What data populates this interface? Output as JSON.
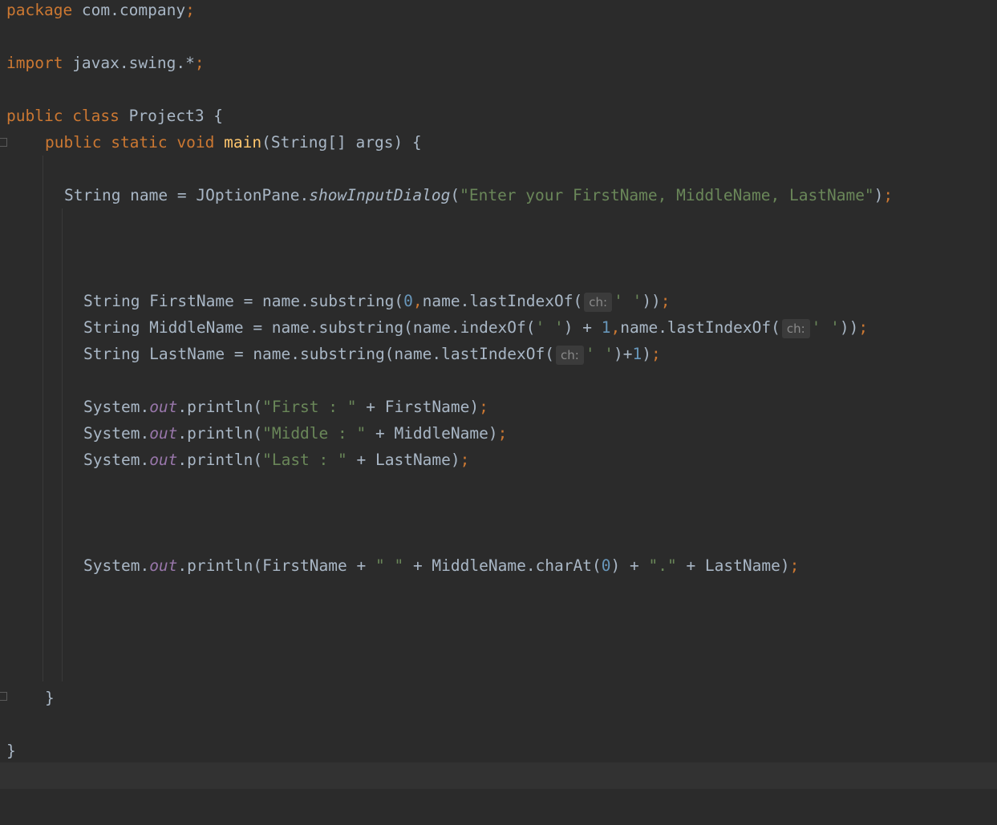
{
  "code": {
    "lines": [
      {
        "indent": 0,
        "tokens": [
          {
            "t": "package",
            "c": "kw"
          },
          {
            "t": " com.company"
          },
          {
            "t": ";",
            "c": "kw"
          }
        ]
      },
      {
        "indent": 0,
        "tokens": []
      },
      {
        "indent": 0,
        "tokens": [
          {
            "t": "import",
            "c": "kw"
          },
          {
            "t": " javax.swing.*"
          },
          {
            "t": ";",
            "c": "kw"
          }
        ]
      },
      {
        "indent": 0,
        "tokens": []
      },
      {
        "indent": 0,
        "tokens": [
          {
            "t": "public",
            "c": "kw"
          },
          {
            "t": " "
          },
          {
            "t": "class",
            "c": "kw"
          },
          {
            "t": " Project3 {"
          }
        ]
      },
      {
        "indent": 1,
        "tokens": [
          {
            "t": "public",
            "c": "kw"
          },
          {
            "t": " "
          },
          {
            "t": "static",
            "c": "kw"
          },
          {
            "t": " "
          },
          {
            "t": "void",
            "c": "kw"
          },
          {
            "t": " "
          },
          {
            "t": "main",
            "c": "mdecl"
          },
          {
            "t": "(String[] args) {"
          }
        ]
      },
      {
        "indent": 0,
        "tokens": []
      },
      {
        "indent": 1.5,
        "tokens": [
          {
            "t": "String name = JOptionPane."
          },
          {
            "t": "showInputDialog",
            "c": "static-m"
          },
          {
            "t": "("
          },
          {
            "t": "\"Enter your FirstName, MiddleName, LastName\"",
            "c": "str"
          },
          {
            "t": ")"
          },
          {
            "t": ";",
            "c": "kw"
          }
        ]
      },
      {
        "indent": 0,
        "tokens": []
      },
      {
        "indent": 0,
        "tokens": []
      },
      {
        "indent": 0,
        "tokens": []
      },
      {
        "indent": 2,
        "tokens": [
          {
            "t": "String FirstName = name.substring("
          },
          {
            "t": "0",
            "c": "num"
          },
          {
            "t": ",",
            "c": "kw"
          },
          {
            "t": "name.lastIndexOf("
          },
          {
            "t": "ch:",
            "c": "hint"
          },
          {
            "t": "' '",
            "c": "str"
          },
          {
            "t": "))"
          },
          {
            "t": ";",
            "c": "kw"
          }
        ]
      },
      {
        "indent": 2,
        "tokens": [
          {
            "t": "String MiddleName = name.substring(name.indexOf("
          },
          {
            "t": "' '",
            "c": "str"
          },
          {
            "t": ") + "
          },
          {
            "t": "1",
            "c": "num"
          },
          {
            "t": ",",
            "c": "kw"
          },
          {
            "t": "name.lastIndexOf("
          },
          {
            "t": "ch:",
            "c": "hint"
          },
          {
            "t": "' '",
            "c": "str"
          },
          {
            "t": "))"
          },
          {
            "t": ";",
            "c": "kw"
          }
        ]
      },
      {
        "indent": 2,
        "tokens": [
          {
            "t": "String LastName = name.substring(name.lastIndexOf("
          },
          {
            "t": "ch:",
            "c": "hint"
          },
          {
            "t": "' '",
            "c": "str"
          },
          {
            "t": ")+"
          },
          {
            "t": "1",
            "c": "num"
          },
          {
            "t": ")"
          },
          {
            "t": ";",
            "c": "kw"
          }
        ]
      },
      {
        "indent": 0,
        "tokens": []
      },
      {
        "indent": 2,
        "tokens": [
          {
            "t": "System."
          },
          {
            "t": "out",
            "c": "fld"
          },
          {
            "t": ".println("
          },
          {
            "t": "\"First : \"",
            "c": "str"
          },
          {
            "t": " + FirstName)"
          },
          {
            "t": ";",
            "c": "kw"
          }
        ]
      },
      {
        "indent": 2,
        "tokens": [
          {
            "t": "System."
          },
          {
            "t": "out",
            "c": "fld"
          },
          {
            "t": ".println("
          },
          {
            "t": "\"Middle : \"",
            "c": "str"
          },
          {
            "t": " + MiddleName)"
          },
          {
            "t": ";",
            "c": "kw"
          }
        ]
      },
      {
        "indent": 2,
        "tokens": [
          {
            "t": "System."
          },
          {
            "t": "out",
            "c": "fld"
          },
          {
            "t": ".println("
          },
          {
            "t": "\"Last : \"",
            "c": "str"
          },
          {
            "t": " + LastName)"
          },
          {
            "t": ";",
            "c": "kw"
          }
        ]
      },
      {
        "indent": 0,
        "tokens": []
      },
      {
        "indent": 0,
        "tokens": []
      },
      {
        "indent": 0,
        "tokens": []
      },
      {
        "indent": 2,
        "tokens": [
          {
            "t": "System."
          },
          {
            "t": "out",
            "c": "fld"
          },
          {
            "t": ".println(FirstName + "
          },
          {
            "t": "\" \"",
            "c": "str"
          },
          {
            "t": " + MiddleName.charAt("
          },
          {
            "t": "0",
            "c": "num"
          },
          {
            "t": ") + "
          },
          {
            "t": "\".\"",
            "c": "str"
          },
          {
            "t": " + LastName)"
          },
          {
            "t": ";",
            "c": "kw"
          }
        ]
      },
      {
        "indent": 0,
        "tokens": []
      },
      {
        "indent": 0,
        "tokens": []
      },
      {
        "indent": 0,
        "tokens": []
      },
      {
        "indent": 0,
        "tokens": []
      },
      {
        "indent": 1,
        "tokens": [
          {
            "t": "}"
          }
        ]
      },
      {
        "indent": 0,
        "tokens": []
      },
      {
        "indent": 0,
        "tokens": [
          {
            "t": "}"
          }
        ]
      }
    ]
  },
  "theme": {
    "background": "#2b2b2b",
    "text": "#a9b7c6",
    "keyword": "#cc7832",
    "string": "#6a8759",
    "number": "#6897bb",
    "field": "#9876aa",
    "method_declaration": "#ffc66d"
  }
}
